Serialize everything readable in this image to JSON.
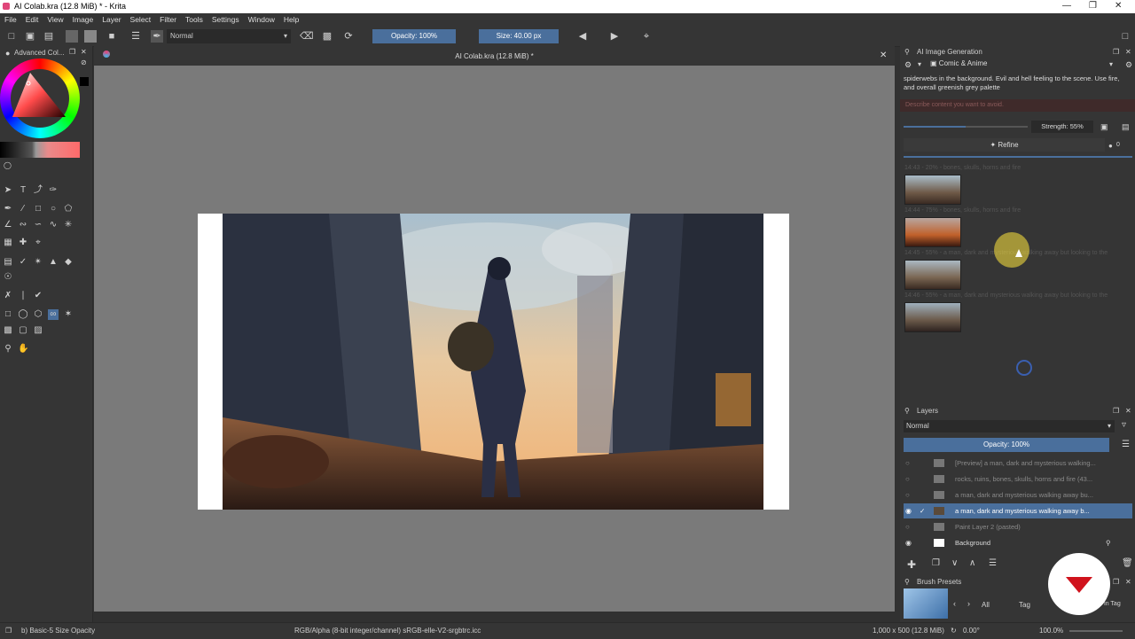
{
  "window": {
    "title": "AI Colab.kra (12.8 MiB) * - Krita",
    "controls": [
      "minimize-icon",
      "restore-icon",
      "close-icon"
    ]
  },
  "menu": [
    "File",
    "Edit",
    "View",
    "Image",
    "Layer",
    "Select",
    "Filter",
    "Tools",
    "Settings",
    "Window",
    "Help"
  ],
  "toolbar": {
    "blend_mode": "Normal",
    "opacity": "Opacity: 100%",
    "size": "Size: 40.00 px"
  },
  "left_dock": {
    "color_panel_title": "Advanced Col..."
  },
  "canvas": {
    "doc_title": "AI Colab.kra (12.8 MiB) *"
  },
  "ai_panel": {
    "title": "AI Image Generation",
    "style": "Comic & Anime",
    "prompt": "spiderwebs in the background. Evil and hell feeling to the scene. Use fire, and overall greenish grey palette",
    "negative_placeholder": "Describe content you want to avoid.",
    "strength": "Strength: 55%",
    "refine_label": "Refine",
    "queue_count": "0",
    "history": [
      {
        "label": "14:43 - 20% - bones, skulls, horns and fire"
      },
      {
        "label": "14:44 - 75% - bones, skulls, horns and fire"
      },
      {
        "label": "14:45 - 55% - a man, dark and mysterious walking away but looking to the"
      },
      {
        "label": "14:46 - 55% - a man, dark and mysterious walking away but looking to the"
      }
    ]
  },
  "layers_panel": {
    "title": "Layers",
    "blend_mode": "Normal",
    "opacity": "Opacity: 100%",
    "layers": [
      {
        "name": "[Preview] a man, dark and mysterious walking...",
        "visible": false,
        "selected": false
      },
      {
        "name": "rocks, ruins, bones, skulls, horns and fire (43...",
        "visible": false,
        "selected": false
      },
      {
        "name": "a man, dark and mysterious walking away bu...",
        "visible": false,
        "selected": false
      },
      {
        "name": "a man, dark and mysterious walking away b...",
        "visible": true,
        "selected": true
      },
      {
        "name": "Paint Layer 2 (pasted)",
        "visible": false,
        "selected": false
      },
      {
        "name": "Background",
        "visible": true,
        "selected": false
      }
    ]
  },
  "brush_presets": {
    "title": "Brush Presets",
    "filter": "All",
    "tag_label": "Tag",
    "filter_in_tag": "er in Tag"
  },
  "status_bar": {
    "brush": "b) Basic-5 Size Opacity",
    "color_profile": "RGB/Alpha (8-bit integer/channel)  sRGB-elle-V2-srgbtrc.icc",
    "dimensions": "1,000 x 500 (12.8 MiB)",
    "rotation": "0.00°",
    "zoom": "100.0%"
  },
  "colors": {
    "accent": "#4a6f9c",
    "panel": "#353535",
    "canvas_bg": "#7a7a7a"
  }
}
